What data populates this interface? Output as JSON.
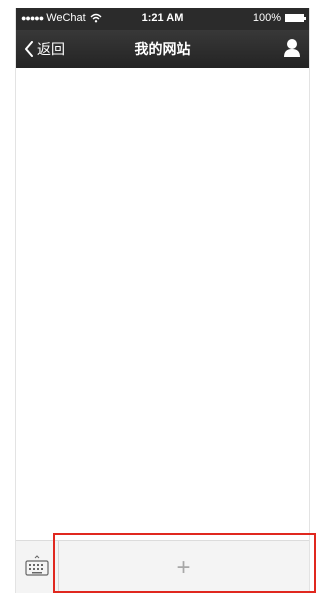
{
  "statusbar": {
    "signal": "●●●●●",
    "carrier": "WeChat",
    "time": "1:21 AM",
    "battery": "100%"
  },
  "navbar": {
    "back_label": "返回",
    "title": "我的网站",
    "profile_icon": "person-icon"
  },
  "bottom_bar": {
    "keyboard_icon": "keyboard-icon",
    "add_label": "+"
  },
  "colors": {
    "navbar": "#2b2b2b",
    "highlight": "#e0281f",
    "plus": "#a8a8a8"
  }
}
